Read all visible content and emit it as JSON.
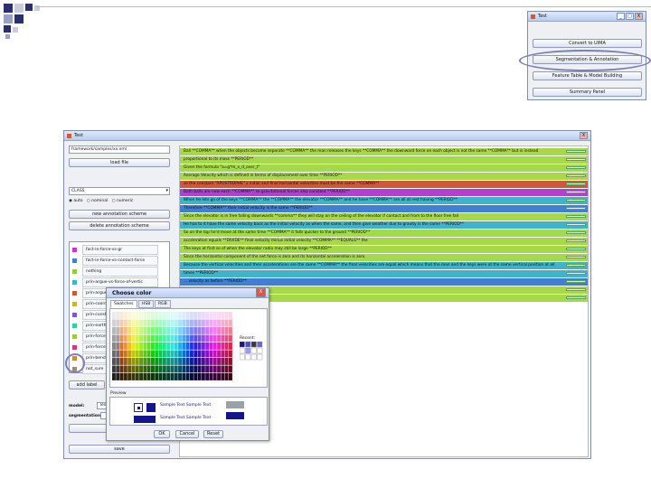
{
  "small_window": {
    "title": "Test",
    "controls": [
      "_",
      "□",
      "X"
    ],
    "buttons": [
      "Convert to UIMA",
      "Segmentation & Annotation",
      "Feature Table & Model Building",
      "Summary Panel"
    ]
  },
  "main_window": {
    "title": "Test",
    "close": "X",
    "file_field": "framework/samples/xx.xml",
    "load_button": "load file",
    "scheme_select": "CLASS",
    "radio_options": [
      "auto",
      "nominal",
      "numeric"
    ],
    "new_scheme_button": "new annotation scheme",
    "delete_scheme_button": "delete annotation scheme",
    "labels": [
      {
        "text": "fact-in-force-vs-gr",
        "color": "#c43ad1"
      },
      {
        "text": "fact-in-force-vs-contact-force",
        "color": "#3f7fd6"
      },
      {
        "text": "nothing",
        "color": "#8bcf3a"
      },
      {
        "text": "prin-argue-vs-force-of-vertic",
        "color": "#3fb3c9"
      },
      {
        "text": "prin-argue",
        "color": "#cc5a3a"
      },
      {
        "text": "prin-coord",
        "color": "#c9b23f"
      },
      {
        "text": "prin-constant",
        "color": "#7a5ad1"
      },
      {
        "text": "prin-earth",
        "color": "#3ac9a2"
      },
      {
        "text": "prin-force",
        "color": "#a3c93a"
      },
      {
        "text": "prin-force",
        "color": "#d13a7a"
      },
      {
        "text": "prin-bend",
        "color": "#c98e3a"
      },
      {
        "text": "not_sure",
        "color": "#a08a7a"
      }
    ],
    "add_label_button": "add label",
    "model_label": "model:",
    "model_value": "Test",
    "segmentation_label": "segmentation:",
    "segmentation_value": "",
    "annotate_button": "annotate",
    "save_button": "save",
    "segments": [
      {
        "text": "Ball **COMMA** when the objects become separate **COMMA** the man releases the keys **COMMA** the downward force on each object is not the same **COMMA** but is instead",
        "color": "#a6d94a"
      },
      {
        "text": "proportional to its mass **PERIOD**",
        "color": "#a6d94a"
      },
      {
        "text": "Given the formula \"a=g*m_x_d_over_t\"",
        "color": "#a6d94a"
      },
      {
        "text": "Average Velocity which is defined in terms of displacement over time **PERIOD**",
        "color": "#a6d94a"
      },
      {
        "text": "so the constant \"APOSTROPHE\" z initial and final horizontal velocities must be the same **COMMA**",
        "color": "#cc5a3a"
      },
      {
        "text": "Both balls are now each **COMMA** so gravitational forces also constant **PERIOD**",
        "color": "#b23fd1"
      },
      {
        "text": "When he lets go of the keys **COMMA** the **COMMA** the elevator **COMMA** and he have **COMMA** are all at rest having **PERIOD**",
        "color": "#3fb3c9"
      },
      {
        "text": "Therefore **COMMA** their initial velocity is the same **PERIOD**",
        "color": "#3f7fd6"
      },
      {
        "text": "Since the elevator is in free falling downwards **comma** they will stay on the ceiling of the elevator if contact and from to the floor free fall",
        "color": "#a6d94a"
      },
      {
        "text": "He has to it have the same velocity back as the initial velocity as when the same, and then give weather due to gravity is the same **PERIOD**",
        "color": "#3fb3c9"
      },
      {
        "text": "So on the top he'd move at the same time **COMMA** it falls quicker to the ground **PERIOD**",
        "color": "#a6d94a"
      },
      {
        "text": "acceleration equals **DIVIDE** final velocity minus initial velocity **COMMA** **EQUALS** the",
        "color": "#a6d94a"
      },
      {
        "text": "The keys at first so of when the elevator radio may still be large **PERIOD**",
        "color": "#a6d94a"
      },
      {
        "text": "Since the horizontal component of the net force is zero and its horizontal acceleration is zero",
        "color": "#a6d94a"
      },
      {
        "text": "Because the vertical velocities and their accelerations are the same **COMMA** the final velocities are equal which means that the man and the keys were at the same vertical position at all",
        "color": "#3fb3c9"
      },
      {
        "text": "times **PERIOD**",
        "color": "#3fb3c9"
      },
      {
        "text": "... velocity as before **PERIOD**",
        "color": "#3f7fd6"
      },
      {
        "text": "",
        "color": "#a6d94a"
      },
      {
        "text": "",
        "color": "#a6d94a"
      }
    ]
  },
  "color_dialog": {
    "title": "Choose color",
    "close": "X",
    "tabs": [
      "Swatches",
      "HSB",
      "RGB"
    ],
    "recent_label": "Recent:",
    "preview_label": "Preview",
    "sample_texts": [
      "Sample Text",
      "Sample Text",
      "Sample Text",
      "Sample Text"
    ],
    "ok_button": "OK",
    "cancel_button": "Cancel",
    "reset_button": "Reset"
  },
  "colors": {
    "title_bar_top": "#dfe9fb",
    "title_bar_bottom": "#b9cdf0",
    "window_bg": "#eef0f4",
    "deco_navy": "#2a2f6e",
    "highlight_ring": "#7a7fb5"
  }
}
